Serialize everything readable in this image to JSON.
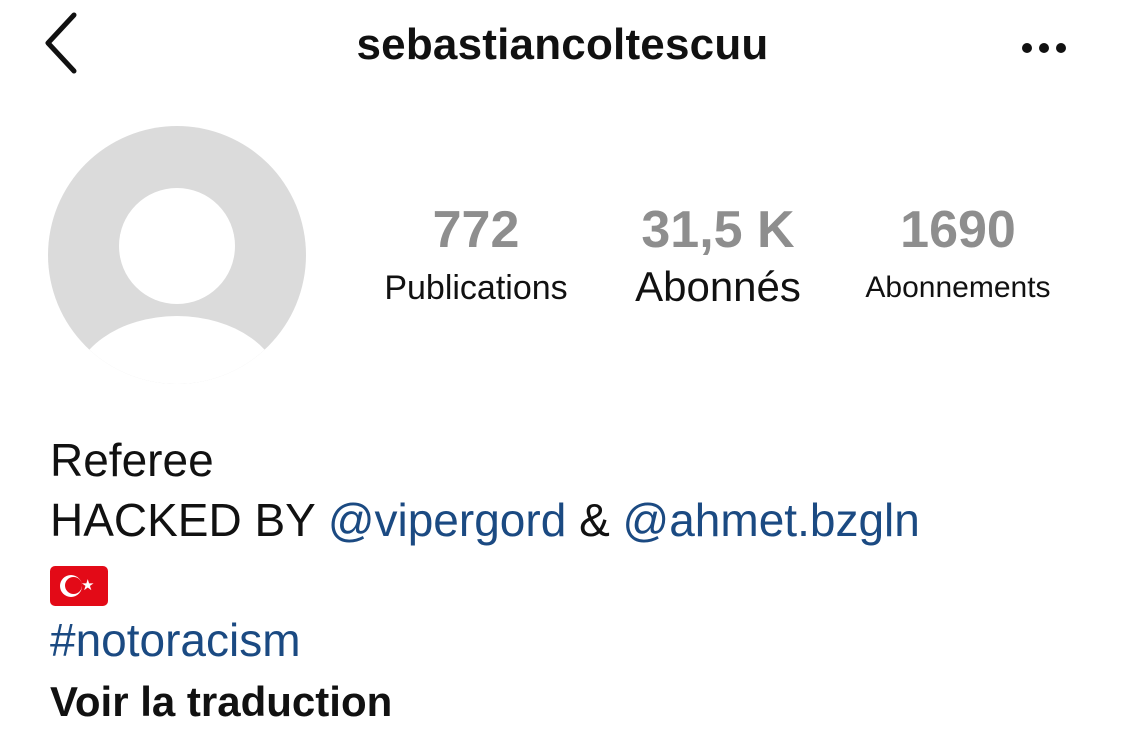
{
  "header": {
    "username": "sebastiancoltescuu"
  },
  "stats": {
    "posts": {
      "value": "772",
      "label": "Publications"
    },
    "followers": {
      "value": "31,5 K",
      "label": "Abonnés"
    },
    "following": {
      "value": "1690",
      "label": "Abonnements"
    }
  },
  "bio": {
    "line1": "Referee",
    "hacked_prefix": "HACKED BY",
    "mention1": "@vipergord",
    "ampersand": "&",
    "mention2": "@ahmet.bzgln",
    "flag": "turkey-flag-emoji",
    "hashtag": "#notoracism",
    "translate_label": "Voir la traduction"
  },
  "colors": {
    "link": "#1b4a82",
    "count": "#8e8e8e",
    "avatar_placeholder": "#dbdbdb",
    "flag_red": "#e30a17"
  }
}
